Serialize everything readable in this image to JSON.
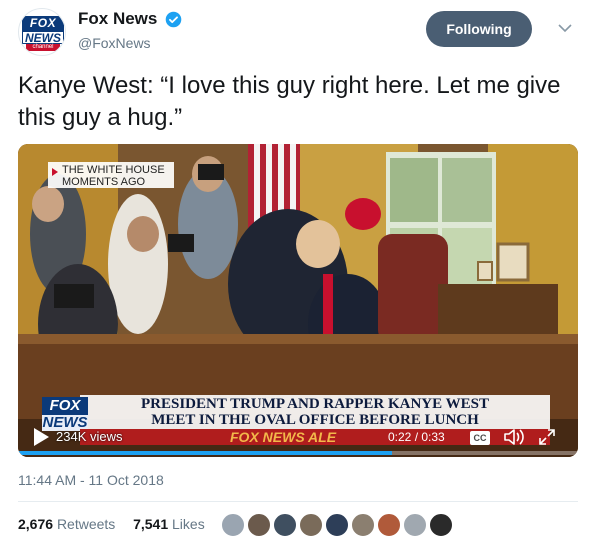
{
  "account": {
    "display_name": "Fox News",
    "handle": "@FoxNews",
    "avatar_logo": {
      "line1": "FOX",
      "line2": "NEWS",
      "line3": "channel"
    },
    "verified": true
  },
  "follow_button": {
    "label": "Following"
  },
  "tweet": {
    "text": "Kanye West: “I love this guy right here. Let me give this guy a hug.”"
  },
  "video": {
    "overlay_label": "THE WHITE HOUSE MOMENTS AGO",
    "chyron_line1": "PRESIDENT TRUMP AND RAPPER KANYE WEST",
    "chyron_line2": "MEET IN THE OVAL OFFICE BEFORE LUNCH",
    "bug_line1": "FOX",
    "bug_line2": "NEWS",
    "ticker_text": "FOX NEWS ALE",
    "views": "234K views",
    "time": "0:22 / 0:33",
    "cc_label": "CC",
    "progress_fraction": 0.667
  },
  "timestamp": "11:44 AM - 11 Oct 2018",
  "stats": {
    "retweets_count": "2,676",
    "retweets_label": "Retweets",
    "likes_count": "7,541",
    "likes_label": "Likes"
  },
  "likers": {
    "count_shown": 9,
    "colors": [
      "#9aa5b1",
      "#6b5a4c",
      "#3f4f60",
      "#7a6b5a",
      "#2d3e58",
      "#8b7f70",
      "#b05a3a",
      "#a0a8b0",
      "#2a2a2a"
    ]
  },
  "colors": {
    "text_primary": "#14171a",
    "text_secondary": "#657786",
    "follow_bg": "#4a5e73",
    "verified": "#1da1f2"
  }
}
